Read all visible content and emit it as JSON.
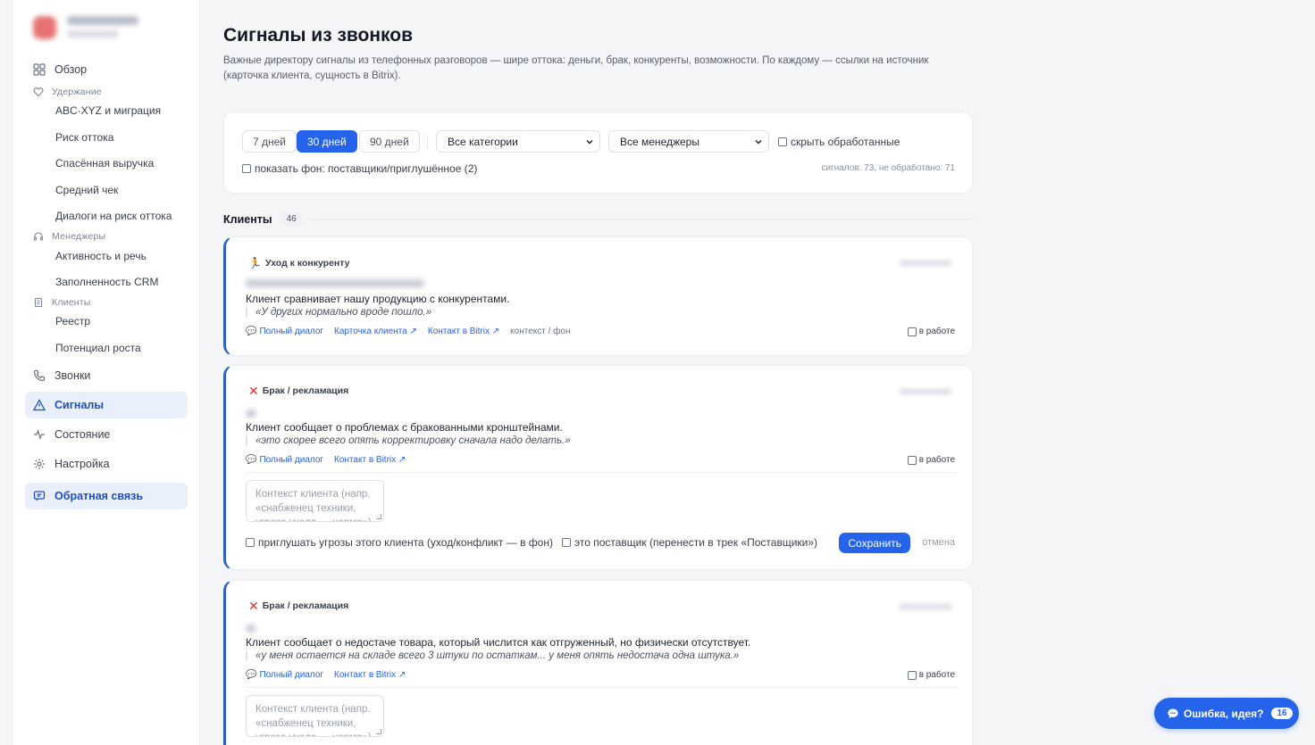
{
  "sidebar": {
    "items": [
      {
        "label": "Обзор"
      },
      {
        "label": "Звонки"
      },
      {
        "label": "Сигналы"
      },
      {
        "label": "Состояние"
      },
      {
        "label": "Настройка"
      }
    ],
    "groups": {
      "retention": {
        "label": "Удержание",
        "items": [
          "ABC·XYZ и миграция",
          "Риск оттока",
          "Спасённая выручка",
          "Средний чек",
          "Диалоги на риск оттока"
        ]
      },
      "managers": {
        "label": "Менеджеры",
        "items": [
          "Активность и речь",
          "Заполненность CRM"
        ]
      },
      "clients": {
        "label": "Клиенты",
        "items": [
          "Реестр",
          "Потенциал роста"
        ]
      }
    },
    "feedback": "Обратная связь"
  },
  "page": {
    "title": "Сигналы из звонков",
    "description": "Важные директору сигналы из телефонных разговоров — шире оттока: деньги, брак, конкуренты, возможности. По каждому — ссылки на источник (карточка клиента, сущность в Bitrix)."
  },
  "filters": {
    "periods": [
      "7 дней",
      "30 дней",
      "90 дней"
    ],
    "active_period": "30 дней",
    "category": "Все категории",
    "manager": "Все менеджеры",
    "hide_processed": "скрыть обработанные",
    "show_background": "показать фон: поставщики/приглушённое (2)",
    "stats": "сигналов: 73, не обработано: 71"
  },
  "section": {
    "title": "Клиенты",
    "count": "46"
  },
  "cards": [
    {
      "category": "Уход к конкуренту",
      "summary": "Клиент сравнивает нашу продукцию с конкурентами.",
      "quote": "«У других нормально вроде пошло.»",
      "links": {
        "dialog": "Полный диалог",
        "card": "Карточка клиента ↗",
        "bitrix": "Контакт в Bitrix ↗",
        "context": "контекст / фон"
      },
      "in_work": "в работе"
    },
    {
      "category": "Брак / рекламация",
      "summary": "Клиент сообщает о проблемах с бракованными кронштейнами.",
      "quote": "«это скорее всего опять корректировку сначала надо делать.»",
      "links": {
        "dialog": "Полный диалог",
        "bitrix": "Контакт в Bitrix ↗"
      },
      "in_work": "в работе",
      "context_placeholder": "Контекст клиента (напр. «снабженец техники, угроза ухода — норма»)",
      "mute_label": "приглушать угрозы этого клиента (уход/конфликт — в фон)",
      "supplier_label": "это поставщик (перенести в трек «Поставщики»)",
      "save": "Сохранить",
      "cancel": "отмена"
    },
    {
      "category": "Брак / рекламация",
      "summary": "Клиент сообщает о недостаче товара, который числится как отгруженный, но физически отсутствует.",
      "quote": "«у меня остается на складе всего 3 штуки по остаткам... у меня опять недостача одна штука.»",
      "links": {
        "dialog": "Полный диалог",
        "bitrix": "Контакт в Bitrix ↗"
      },
      "in_work": "в работе",
      "context_placeholder": "Контекст клиента (напр. «снабженец техники, угроза ухода — норма»)"
    }
  ],
  "fab": {
    "label": "Ошибка, идея?",
    "count": "16"
  },
  "colors": {
    "accent": "#2563eb",
    "active_bg": "#eaf0fb",
    "danger": "#e03131"
  }
}
